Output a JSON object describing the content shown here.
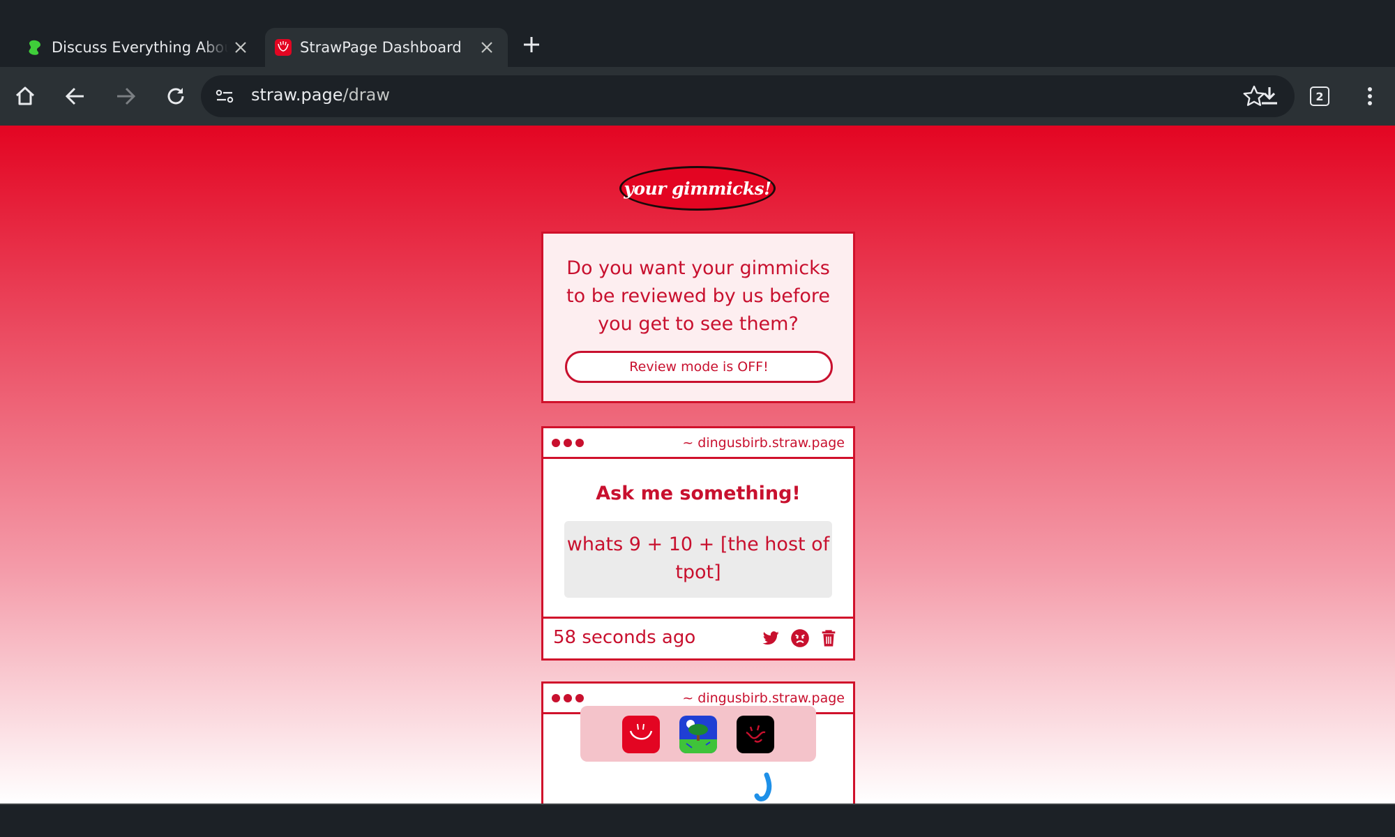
{
  "tabs": [
    {
      "title": "Discuss Everything About B",
      "favicon": "green-blob-icon",
      "active": false
    },
    {
      "title": "StrawPage Dashboard",
      "favicon": "strawpage-icon",
      "active": true
    }
  ],
  "toolbar": {
    "url_host": "straw.page",
    "url_path": "/draw",
    "tab_count": "2"
  },
  "logo": {
    "text": "your gimmicks!"
  },
  "review": {
    "question": "Do you want your gimmicks to be reviewed by us before you get to see them?",
    "toggle_label": "Review mode is OFF!"
  },
  "posts": [
    {
      "owner": "~ dingusbirb.straw.page",
      "title": "Ask me something!",
      "question": "whats 9 + 10 + [the host of tpot]",
      "time_ago": "58 seconds ago"
    },
    {
      "owner": "~ dingusbirb.straw.page"
    }
  ],
  "colors": {
    "brand_red": "#c8102e",
    "page_top": "#e30522",
    "chrome_dark": "#1c2126",
    "chrome_toolbar": "#2b3135"
  }
}
